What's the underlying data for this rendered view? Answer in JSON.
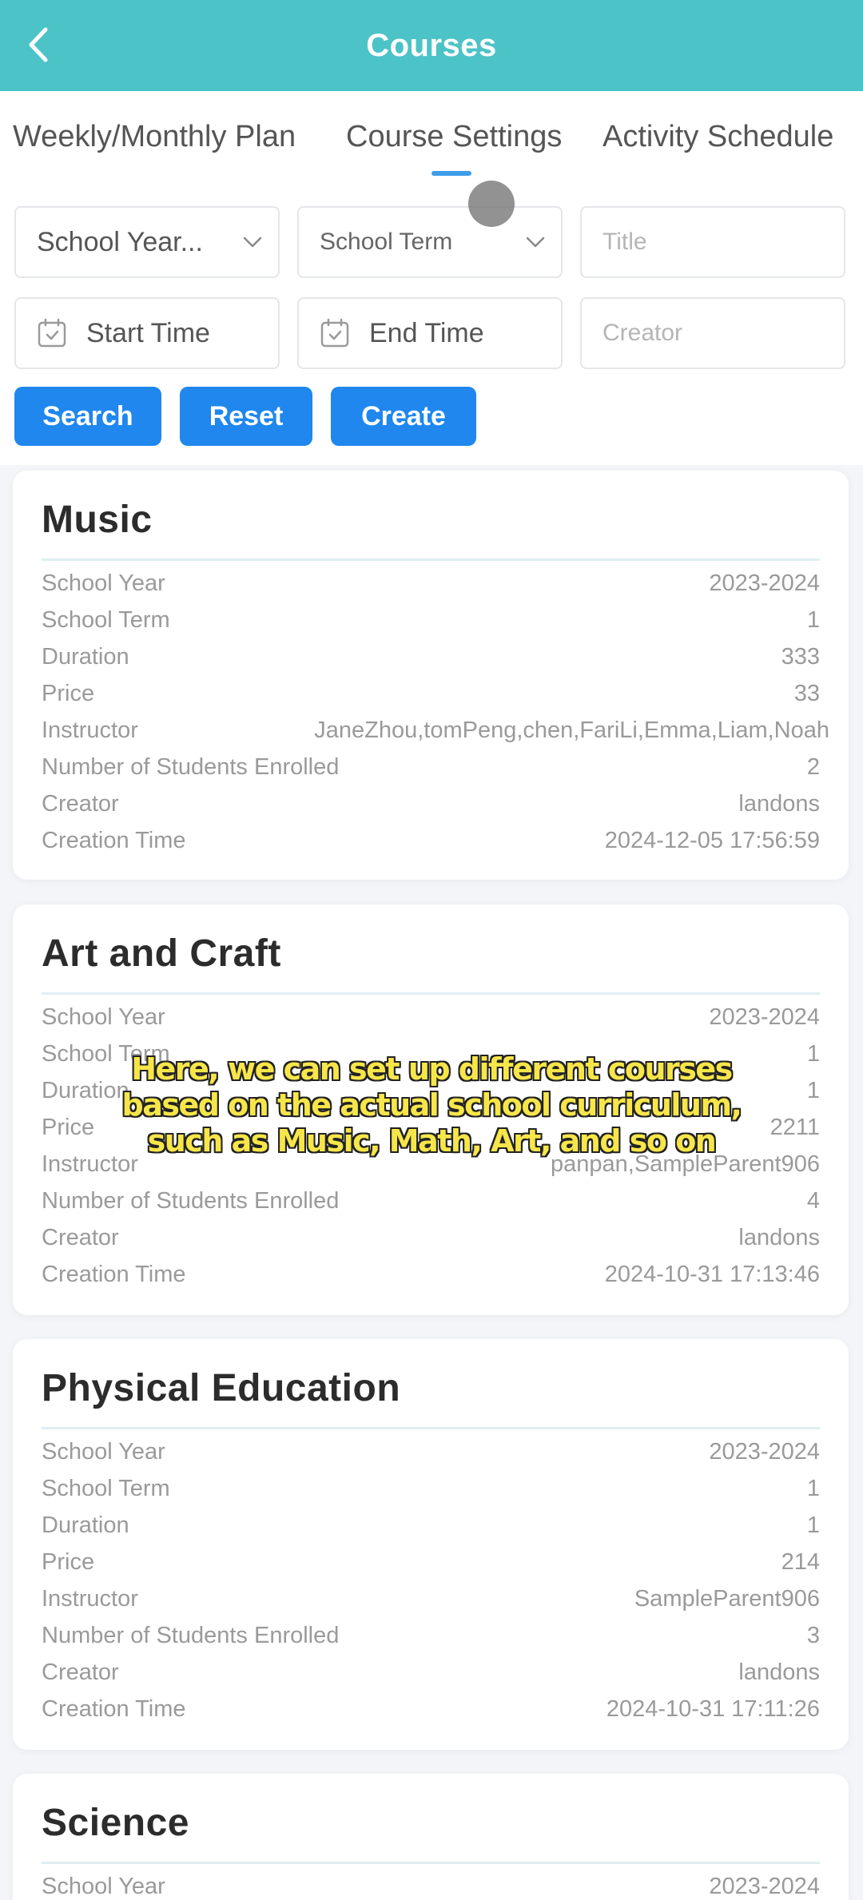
{
  "header": {
    "title": "Courses",
    "accent_color": "#4cc3c6",
    "back_icon": "chevron-left-icon"
  },
  "tabs": [
    {
      "label": "Weekly/Monthly Plan",
      "active": false
    },
    {
      "label": "Course Settings",
      "active": true
    },
    {
      "label": "Activity Schedule",
      "active": false
    }
  ],
  "filters": {
    "school_year": {
      "value": "School Year...",
      "icon": "chevron-down-icon"
    },
    "school_term": {
      "value": "School Term",
      "icon": "chevron-down-icon"
    },
    "title": {
      "placeholder": "Title"
    },
    "start_time": {
      "placeholder": "Start Time",
      "icon": "calendar-icon"
    },
    "end_time": {
      "placeholder": "End Time",
      "icon": "calendar-icon"
    },
    "creator": {
      "placeholder": "Creator"
    }
  },
  "buttons": {
    "search": "Search",
    "reset": "Reset",
    "create": "Create",
    "color": "#1f87ee"
  },
  "field_labels": {
    "school_year": "School Year",
    "school_term": "School Term",
    "duration": "Duration",
    "price": "Price",
    "instructor": "Instructor",
    "students": "Number of Students Enrolled",
    "creator": "Creator",
    "creation_time": "Creation Time"
  },
  "courses": [
    {
      "name": "Music",
      "school_year": "2023-2024",
      "school_term": "1",
      "duration": "333",
      "price": "33",
      "instructor": "JaneZhou,tomPeng,chen,FariLi,Emma,Liam,Noah",
      "students": "2",
      "creator": "landons",
      "creation_time": "2024-12-05 17:56:59"
    },
    {
      "name": "Art and Craft",
      "school_year": "2023-2024",
      "school_term": "1",
      "duration": "1",
      "price": "2211",
      "instructor": "panpan,SampleParent906",
      "students": "4",
      "creator": "landons",
      "creation_time": "2024-10-31 17:13:46"
    },
    {
      "name": "Physical Education",
      "school_year": "2023-2024",
      "school_term": "1",
      "duration": "1",
      "price": "214",
      "instructor": "SampleParent906",
      "students": "3",
      "creator": "landons",
      "creation_time": "2024-10-31 17:11:26"
    },
    {
      "name": "Science",
      "school_year": "2023-2024"
    }
  ],
  "subtitle": {
    "lines": [
      "Here, we can set up different courses",
      "based on the actual school curriculum,",
      "such as Music, Math, Art, and so on"
    ],
    "color": "#f7e64a"
  }
}
